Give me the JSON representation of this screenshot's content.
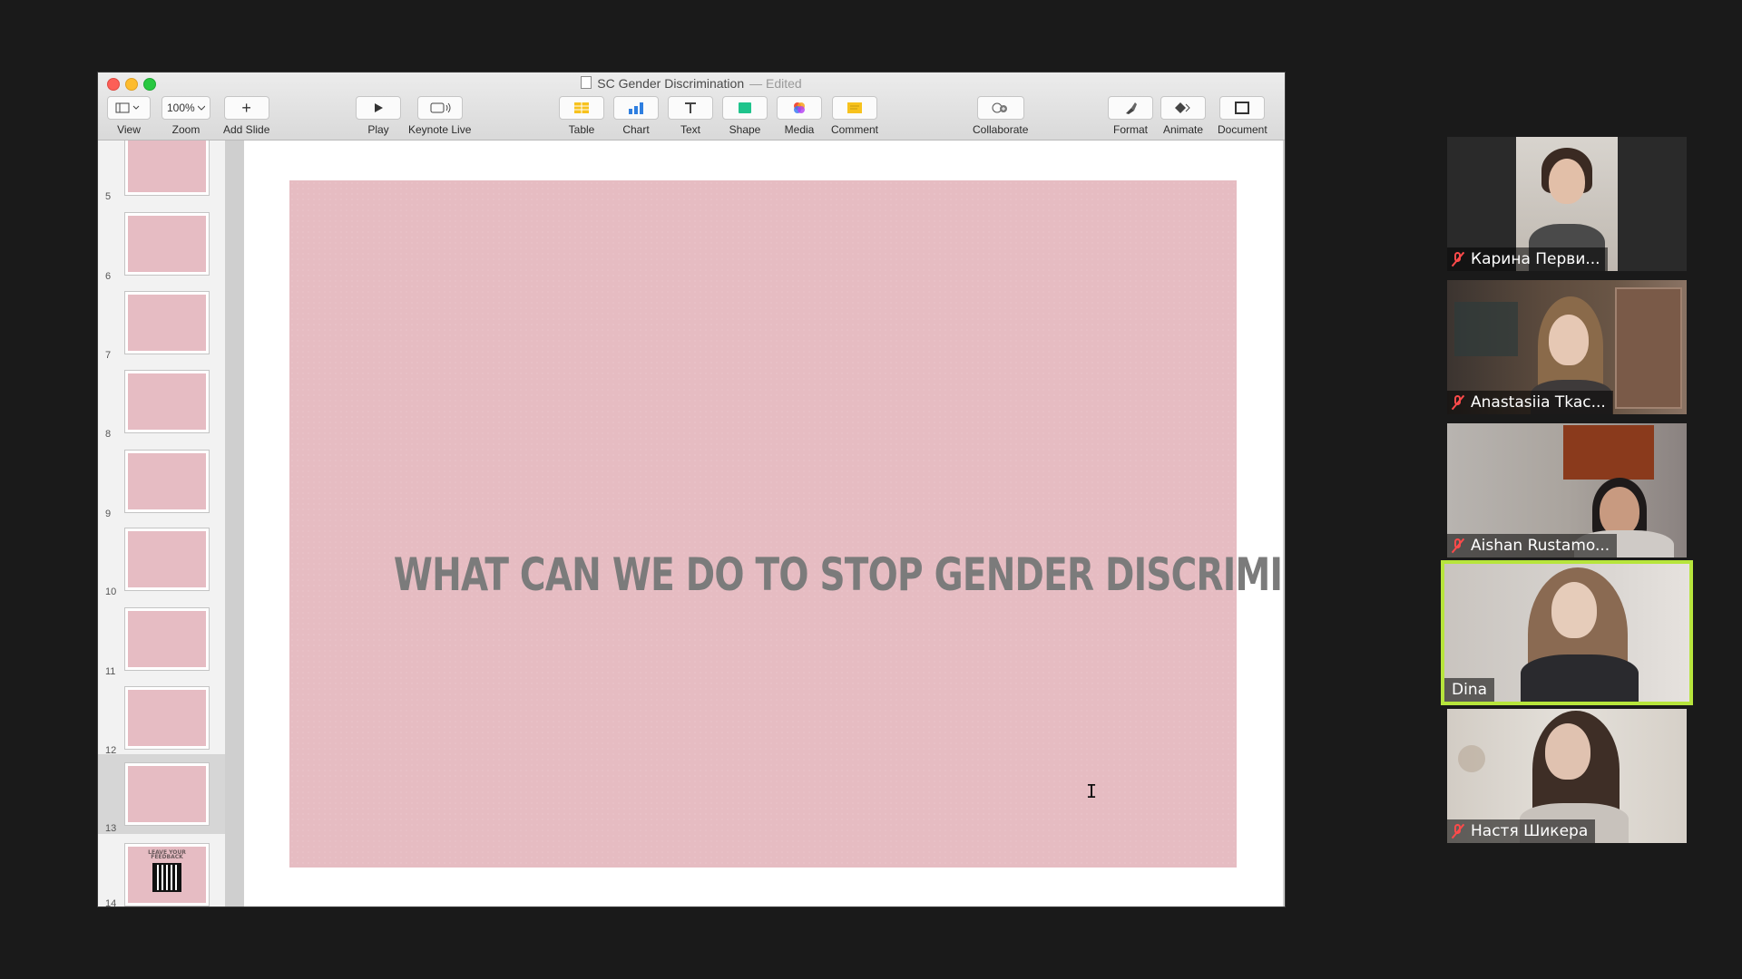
{
  "window": {
    "title": "SC Gender Discrimination",
    "status": "— Edited",
    "zoom": "100%"
  },
  "toolbar": [
    {
      "id": "view",
      "label": "View",
      "icon": "sidebar-view-icon"
    },
    {
      "id": "zoom",
      "label": "Zoom",
      "value": "100%"
    },
    {
      "id": "add-slide",
      "label": "Add Slide",
      "icon": "plus-icon"
    },
    {
      "id": "play",
      "label": "Play",
      "icon": "play-icon"
    },
    {
      "id": "keynote-live",
      "label": "Keynote Live",
      "icon": "keynote-live-icon"
    },
    {
      "id": "table",
      "label": "Table",
      "icon": "table-icon"
    },
    {
      "id": "chart",
      "label": "Chart",
      "icon": "chart-icon"
    },
    {
      "id": "text",
      "label": "Text",
      "icon": "text-icon"
    },
    {
      "id": "shape",
      "label": "Shape",
      "icon": "shape-icon"
    },
    {
      "id": "media",
      "label": "Media",
      "icon": "media-icon"
    },
    {
      "id": "comment",
      "label": "Comment",
      "icon": "comment-icon"
    },
    {
      "id": "collaborate",
      "label": "Collaborate",
      "icon": "collaborate-icon"
    },
    {
      "id": "format",
      "label": "Format",
      "icon": "format-brush-icon"
    },
    {
      "id": "animate",
      "label": "Animate",
      "icon": "animate-icon"
    },
    {
      "id": "document",
      "label": "Document",
      "icon": "document-icon"
    }
  ],
  "slides": [
    {
      "num": "5",
      "text": ""
    },
    {
      "num": "6",
      "text": ""
    },
    {
      "num": "7",
      "text": ""
    },
    {
      "num": "8",
      "text": ""
    },
    {
      "num": "9",
      "text": ""
    },
    {
      "num": "10",
      "text": ""
    },
    {
      "num": "11",
      "text": ""
    },
    {
      "num": "12",
      "text": ""
    },
    {
      "num": "13",
      "text": "",
      "selected": true
    },
    {
      "num": "14",
      "text": "LEAVE YOUR FEEDBACK"
    }
  ],
  "current_slide": {
    "title": "WHAT CAN WE DO TO STOP GENDER DISCRIMINATION?",
    "background": "#e6bcc2"
  },
  "participants": [
    {
      "name": "Карина Перви...",
      "muted": true
    },
    {
      "name": "Anastasiia Tkac...",
      "muted": true
    },
    {
      "name": "Aishan Rustamo...",
      "muted": true
    },
    {
      "name": "Dina",
      "muted": false,
      "active": true
    },
    {
      "name": "Настя Шикера",
      "muted": true
    }
  ],
  "colors": {
    "active_speaker": "#b7e53c",
    "mute": "#ff4a4a"
  }
}
